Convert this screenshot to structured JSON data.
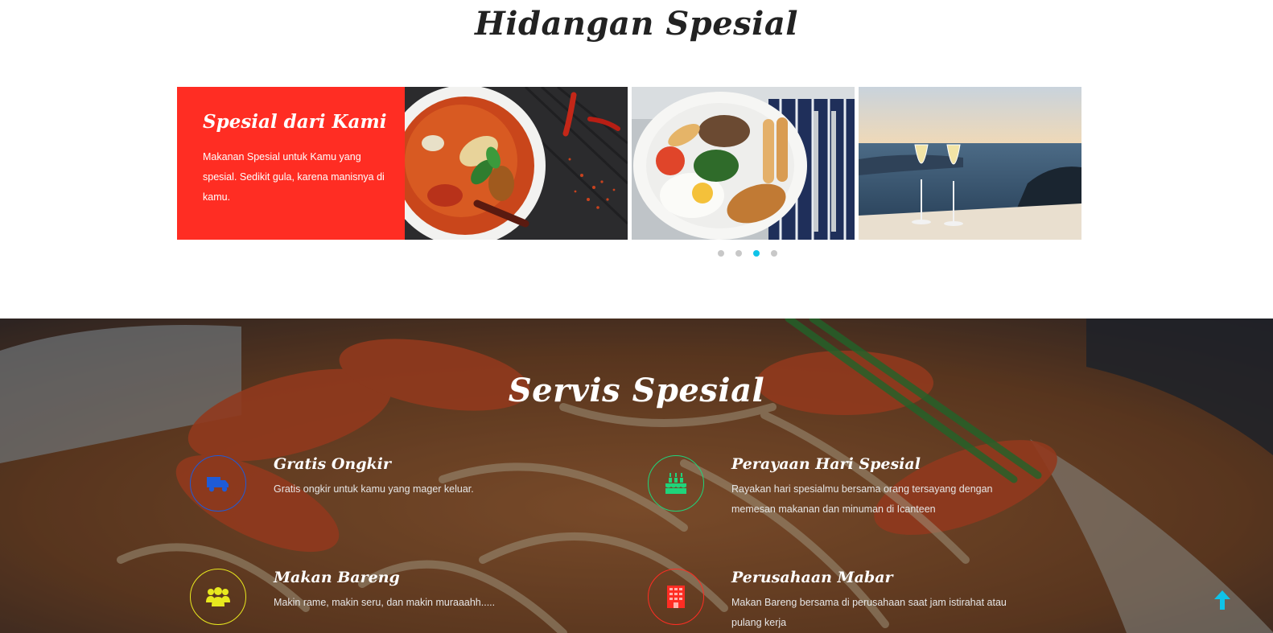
{
  "special_dishes": {
    "title": "Hidangan Spesial",
    "promo": {
      "heading": "Spesial dari Kami",
      "text": "Makanan Spesial untuk Kamu yang spesial. Sedikit gula, karena manisnya di kamu."
    },
    "slides": [
      "curry-soup-photo",
      "breakfast-plate-photo",
      "champagne-sea-view-photo"
    ],
    "pagination": {
      "count": 4,
      "active_index": 2
    }
  },
  "services": {
    "title": "Servis Spesial",
    "items": [
      {
        "title": "Gratis Ongkir",
        "text": "Gratis ongkir untuk kamu yang mager keluar.",
        "icon": "truck-icon",
        "color": "#1e5bd8"
      },
      {
        "title": "Perayaan Hari Spesial",
        "text": "Rayakan hari spesialmu bersama orang tersayang dengan memesan makanan dan minuman di Icanteen",
        "icon": "birthday-cake-icon",
        "color": "#1fd47a"
      },
      {
        "title": "Makan Bareng",
        "text": "Makin rame, makin seru, dan makin muraaahh.....",
        "icon": "group-icon",
        "color": "#e8e81e"
      },
      {
        "title": "Perusahaan Mabar",
        "text": "Makan Bareng bersama di perusahaan saat jam istirahat atau pulang kerja",
        "icon": "building-icon",
        "color": "#ff2d23"
      }
    ]
  },
  "colors": {
    "promo_bg": "#ff2d23",
    "dot_active": "#0fc3e8",
    "back_to_top": "#0fc3e8"
  },
  "back_to_top_icon": "arrow-up-icon"
}
